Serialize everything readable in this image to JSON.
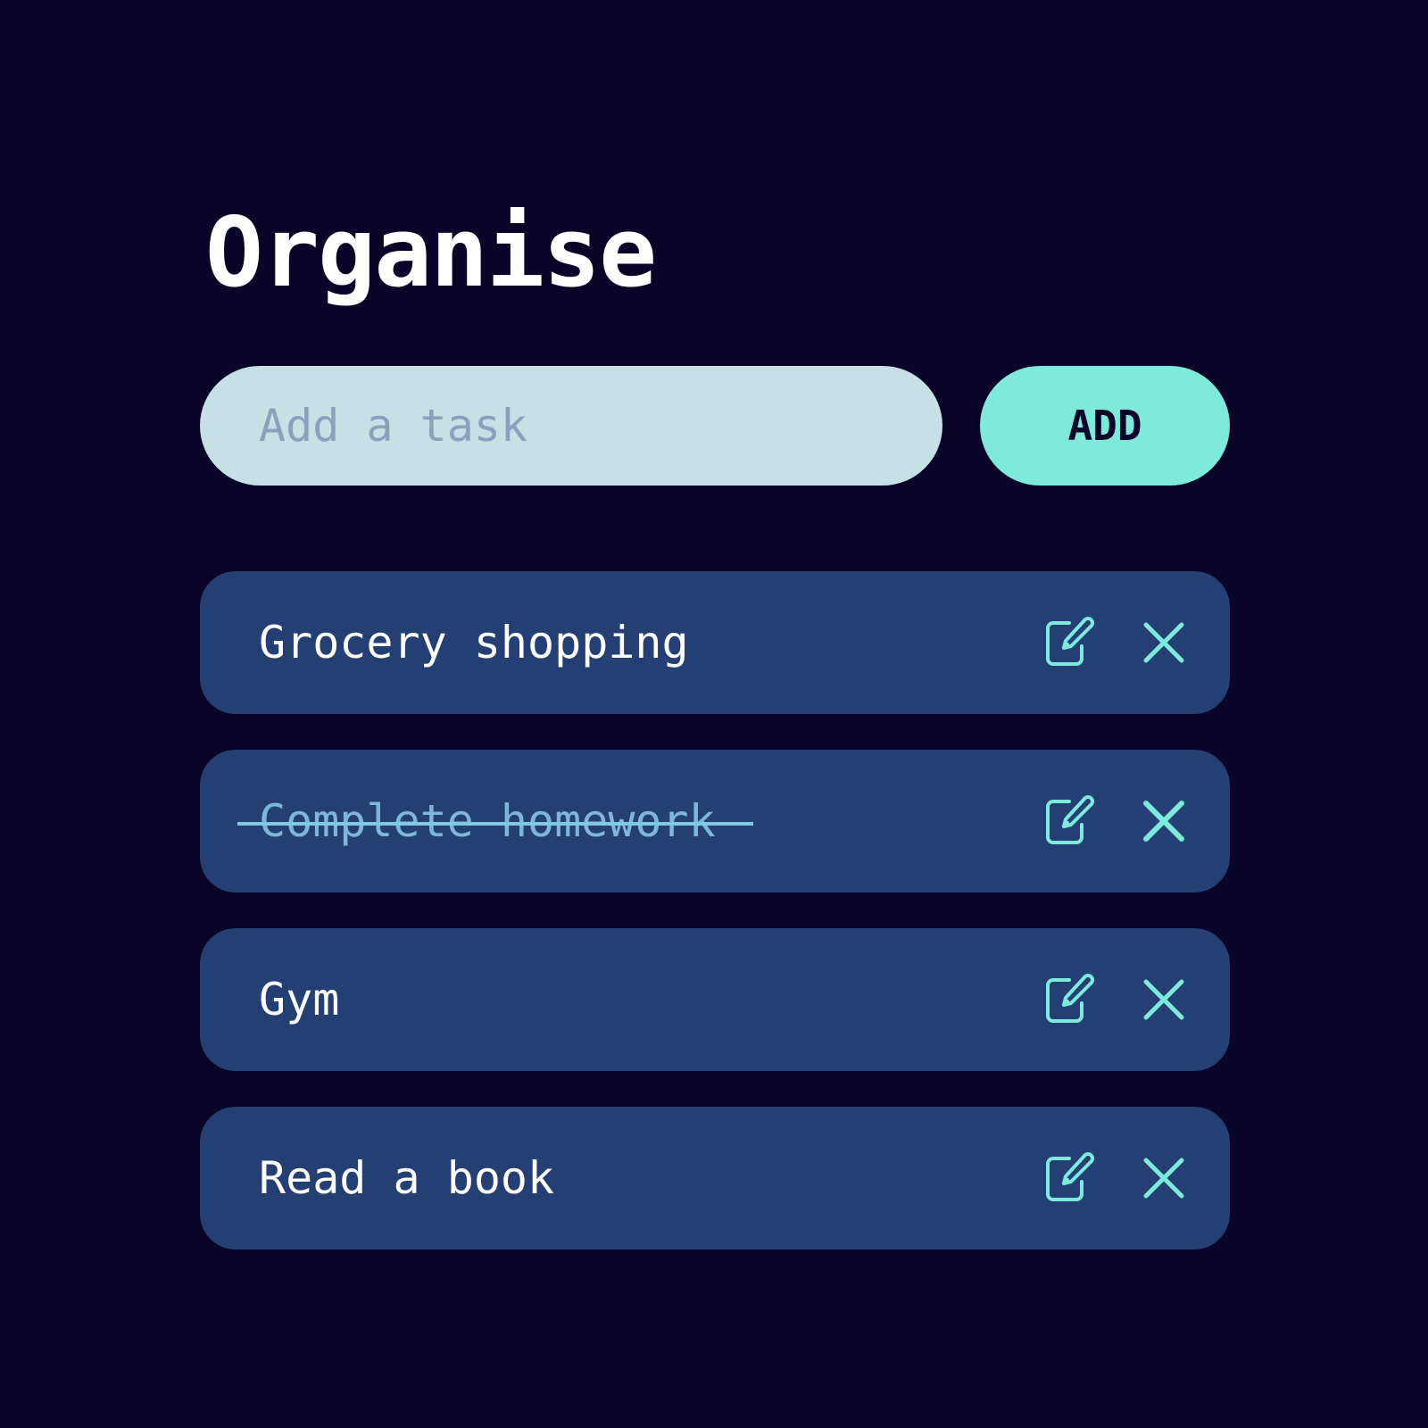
{
  "app": {
    "title": "Organise"
  },
  "new_task": {
    "placeholder": "Add a task",
    "value": "",
    "add_label": "ADD"
  },
  "tasks": [
    {
      "text": "Grocery shopping",
      "completed": false
    },
    {
      "text": "Complete homework",
      "completed": true
    },
    {
      "text": "Gym",
      "completed": false
    },
    {
      "text": "Read a book",
      "completed": false
    }
  ],
  "icons": {
    "edit": "edit-icon",
    "delete": "close-icon"
  },
  "colors": {
    "background": "#0a0528",
    "card": "#243f73",
    "accent": "#7deadb",
    "input": "#c7e0e6",
    "completed_text": "#7fb6dc"
  }
}
